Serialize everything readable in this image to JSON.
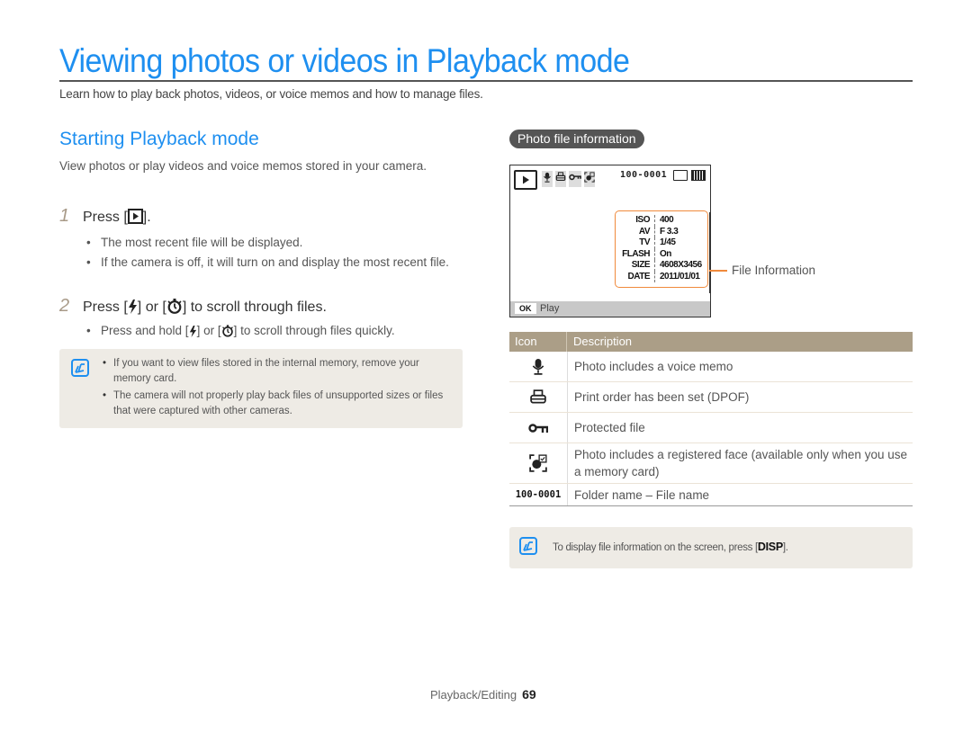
{
  "page": {
    "title": "Viewing photos or videos in Playback mode",
    "intro": "Learn how to play back photos, videos, or voice memos and how to manage files."
  },
  "section": {
    "heading": "Starting Playback mode",
    "description": "View photos or play videos and voice memos stored in your camera.",
    "steps": [
      {
        "number": "1",
        "text_before": "Press [",
        "key_icon": "playback-key-icon",
        "text_after": "].",
        "bullets": [
          "The most recent file will be displayed.",
          "If the camera is off, it will turn on and display the most recent file."
        ]
      },
      {
        "number": "2",
        "text_before": "Press [",
        "key1_icon": "flash-key-icon",
        "text_middle": "] or [",
        "key2_icon": "timer-key-icon",
        "text_after": "] to scroll through files.",
        "bullets": [
          {
            "before": "Press and hold [",
            "middle": "] or [",
            "after": "] to scroll through files quickly."
          }
        ]
      }
    ],
    "note": {
      "icon": "note-icon",
      "bullets": [
        "If you want to view files stored in the internal memory, remove your memory card.",
        "The camera will not properly play back files of unsupported sizes or files that were captured with other cameras."
      ]
    }
  },
  "photo_info": {
    "pill_label": "Photo file information",
    "screen": {
      "top_icons": [
        "voice-memo-icon",
        "print-icon",
        "protect-key-icon",
        "face-icon"
      ],
      "file_number": "100-0001",
      "memory_icon": "internal-memory-icon",
      "battery_icon": "battery-icon",
      "info_rows": [
        {
          "key": "ISO",
          "value": "400"
        },
        {
          "key": "AV",
          "value": "F 3.3"
        },
        {
          "key": "TV",
          "value": "1/45"
        },
        {
          "key": "FLASH",
          "value": "On"
        },
        {
          "key": "SIZE",
          "value": "4608X3456"
        },
        {
          "key": "DATE",
          "value": "2011/01/01"
        }
      ],
      "ok_label": "OK",
      "play_label": "Play"
    },
    "callout_label": "File Information",
    "accent_color": "#f08a3c"
  },
  "icon_table": {
    "headers": [
      "Icon",
      "Description"
    ],
    "rows": [
      {
        "icon": "voice-memo-icon",
        "description": "Photo includes a voice memo"
      },
      {
        "icon": "print-icon",
        "description": "Print order has been set (DPOF)"
      },
      {
        "icon": "protect-key-icon",
        "description": "Protected file"
      },
      {
        "icon": "face-icon",
        "description": "Photo includes a registered face (available only when you use a memory card)"
      },
      {
        "icon_text": "100-0001",
        "description": "Folder name – File name"
      }
    ]
  },
  "tip": {
    "text_before": "To display file information on the screen, press [",
    "key": "DISP",
    "text_after": "]."
  },
  "footer": {
    "section": "Playback/Editing",
    "page_number": "69"
  },
  "colors": {
    "title_blue": "#1e8ff0",
    "table_header": "#ab9e87",
    "note_bg": "#eeebe5",
    "step_number": "#a89a88"
  }
}
